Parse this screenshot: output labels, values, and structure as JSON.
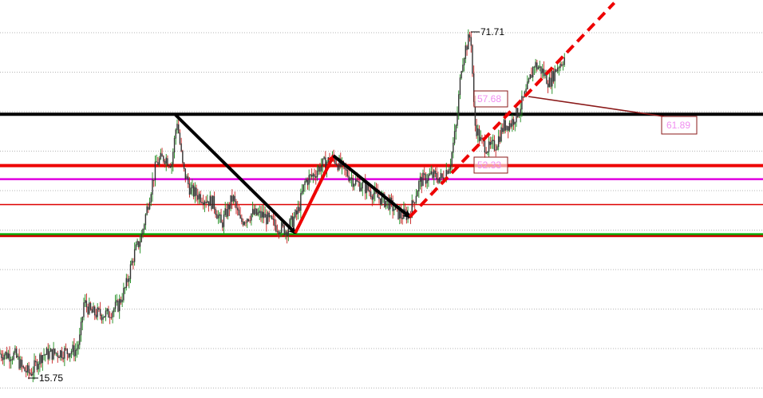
{
  "chart_data": {
    "type": "candlestick",
    "title": "",
    "xlabel": "",
    "ylabel": "",
    "grid": true,
    "y_range_approx": [
      14,
      76
    ],
    "annotations": {
      "high_label": "71.71",
      "low_label": "15.75",
      "box_upper": "57.68",
      "box_lower": "52.33",
      "target_label": "61.89"
    },
    "levels": [
      {
        "value": 58.4,
        "color": "#000000",
        "style": "solid-thick"
      },
      {
        "value": 50.1,
        "color": "#ee0000",
        "style": "solid-thick"
      },
      {
        "value": 47.9,
        "color": "#e000e0",
        "style": "solid"
      },
      {
        "value": 43.8,
        "color": "#dd0000",
        "style": "solid-thin"
      },
      {
        "value": 39.0,
        "color": "#00aa00",
        "style": "solid"
      },
      {
        "value": 38.7,
        "color": "#cc0000",
        "style": "solid"
      }
    ],
    "swings": [
      {
        "from": [
          0.23,
          58.3
        ],
        "to": [
          0.387,
          39.2
        ],
        "color": "#000000",
        "style": "arrow"
      },
      {
        "from": [
          0.387,
          39.2
        ],
        "to": [
          0.437,
          51.7
        ],
        "color": "#ee0000",
        "style": "arrow"
      },
      {
        "from": [
          0.437,
          51.7
        ],
        "to": [
          0.537,
          41.8
        ],
        "color": "#000000",
        "style": "arrow"
      },
      {
        "from": [
          0.537,
          41.8
        ],
        "to": [
          0.805,
          76.4
        ],
        "color": "#ee0000",
        "style": "dashed"
      }
    ],
    "price_path": [
      [
        0.0,
        19.7
      ],
      [
        0.02,
        19.4
      ],
      [
        0.03,
        17.2
      ],
      [
        0.04,
        16.5
      ],
      [
        0.055,
        19.5
      ],
      [
        0.085,
        20.0
      ],
      [
        0.1,
        20.2
      ],
      [
        0.105,
        22.3
      ],
      [
        0.11,
        28.0
      ],
      [
        0.12,
        26.3
      ],
      [
        0.14,
        26.0
      ],
      [
        0.155,
        27.5
      ],
      [
        0.165,
        30.5
      ],
      [
        0.175,
        35.5
      ],
      [
        0.185,
        38.5
      ],
      [
        0.195,
        44.5
      ],
      [
        0.205,
        50.5
      ],
      [
        0.215,
        51.5
      ],
      [
        0.225,
        50.5
      ],
      [
        0.232,
        57.5
      ],
      [
        0.24,
        49.5
      ],
      [
        0.25,
        46.0
      ],
      [
        0.265,
        45.0
      ],
      [
        0.28,
        44.0
      ],
      [
        0.29,
        40.5
      ],
      [
        0.305,
        45.0
      ],
      [
        0.315,
        41.0
      ],
      [
        0.33,
        42.3
      ],
      [
        0.345,
        42.0
      ],
      [
        0.36,
        40.5
      ],
      [
        0.375,
        39.6
      ],
      [
        0.39,
        42.5
      ],
      [
        0.4,
        47.5
      ],
      [
        0.41,
        48.5
      ],
      [
        0.42,
        50.0
      ],
      [
        0.437,
        51.3
      ],
      [
        0.45,
        49.5
      ],
      [
        0.465,
        47.5
      ],
      [
        0.48,
        46.5
      ],
      [
        0.495,
        45.0
      ],
      [
        0.51,
        44.0
      ],
      [
        0.525,
        42.0
      ],
      [
        0.537,
        42.3
      ],
      [
        0.55,
        47.5
      ],
      [
        0.565,
        48.5
      ],
      [
        0.58,
        48.0
      ],
      [
        0.59,
        50.5
      ],
      [
        0.598,
        56.5
      ],
      [
        0.605,
        66.5
      ],
      [
        0.61,
        69.0
      ],
      [
        0.617,
        71.4
      ],
      [
        0.622,
        57.0
      ],
      [
        0.63,
        54.0
      ],
      [
        0.64,
        52.8
      ],
      [
        0.65,
        53.5
      ],
      [
        0.66,
        56.5
      ],
      [
        0.67,
        57.0
      ],
      [
        0.68,
        59.0
      ],
      [
        0.69,
        62.0
      ],
      [
        0.7,
        66.5
      ],
      [
        0.71,
        65.5
      ],
      [
        0.72,
        63.5
      ],
      [
        0.73,
        66.0
      ],
      [
        0.74,
        67.5
      ]
    ]
  }
}
